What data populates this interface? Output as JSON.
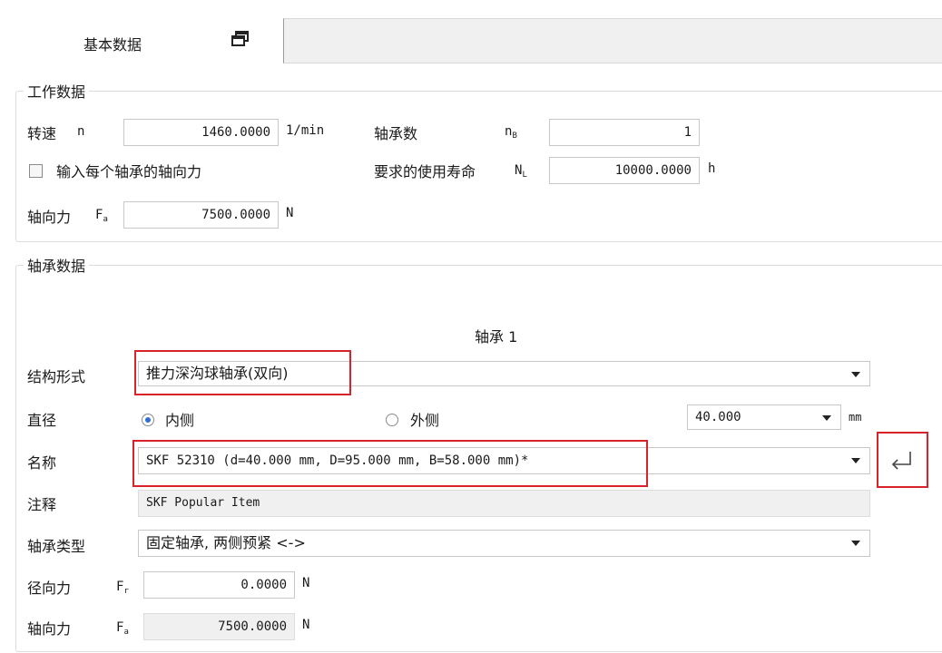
{
  "tab": {
    "label": "基本数据",
    "restore_icon": "window-restore-icon"
  },
  "work": {
    "title": "工作数据",
    "speed": {
      "label": "转速",
      "sym": "n",
      "value": "1460.0000",
      "unit": "1/min"
    },
    "bearing_count": {
      "label": "轴承数",
      "sym": "n",
      "sym_sub": "B",
      "value": "1"
    },
    "checkbox_label": "输入每个轴承的轴向力",
    "life": {
      "label": "要求的使用寿命",
      "sym": "N",
      "sym_sub": "L",
      "value": "10000.0000",
      "unit": "h"
    },
    "axial": {
      "label": "轴向力",
      "sym": "F",
      "sym_sub": "a",
      "value": "7500.0000",
      "unit": "N"
    }
  },
  "bearing": {
    "title": "轴承数据",
    "column_header": "轴承 1",
    "structure": {
      "label": "结构形式",
      "value": "推力深沟球轴承(双向)"
    },
    "diameter": {
      "label": "直径",
      "inner": "内侧",
      "outer": "外侧",
      "value": "40.000",
      "unit": "mm"
    },
    "name": {
      "label": "名称",
      "value": "SKF 52310 (d=40.000 mm, D=95.000 mm, B=58.000 mm)*",
      "apply_icon": "return-arrow-icon"
    },
    "note": {
      "label": "注释",
      "value": "SKF Popular Item"
    },
    "type": {
      "label": "轴承类型",
      "value": "固定轴承, 两侧预紧 <->"
    },
    "radial_force": {
      "label": "径向力",
      "sym": "F",
      "sym_sub": "r",
      "value": "0.0000",
      "unit": "N"
    },
    "axial_force": {
      "label": "轴向力",
      "sym": "F",
      "sym_sub": "a",
      "value": "7500.0000",
      "unit": "N"
    }
  },
  "colors": {
    "highlight": "#d9222a",
    "radio_on": "#2a6fd1"
  }
}
